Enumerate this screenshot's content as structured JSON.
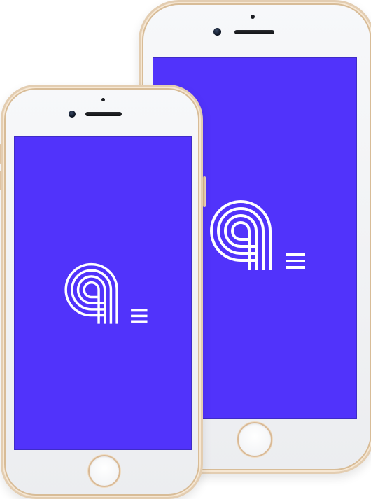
{
  "scene": {
    "description_free": true
  },
  "devices": [
    {
      "id": "back",
      "frame_color": "#e3cdb1",
      "screen_color": "#5133fb",
      "logo_icon": "a-monogram-icon",
      "menu_icon": "menu-lines-icon"
    },
    {
      "id": "front",
      "frame_color": "#e3cdb1",
      "screen_color": "#5133fb",
      "logo_icon": "a-monogram-icon",
      "menu_icon": "menu-lines-icon"
    }
  ],
  "colors": {
    "screen": "#5133fb",
    "logo": "#ffffff",
    "frame_gold": "#e3cdb1",
    "body_white": "#f4f5f7"
  }
}
